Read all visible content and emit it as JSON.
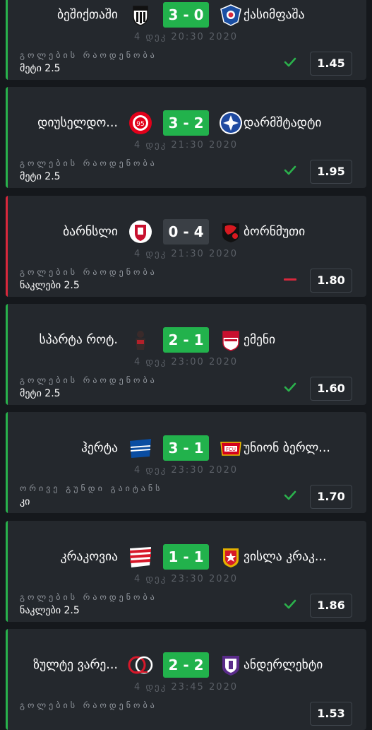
{
  "bets": [
    {
      "result": "win",
      "home": "ბეშიქთაში",
      "home_logo": "besiktas-logo",
      "score": "3 - 0",
      "score_style": "green",
      "away": "ქასიმფაშა",
      "away_logo": "kasimpasa-logo",
      "datetime": "4 დეკ 20:30 2020",
      "market": "გოლების რაოდენობა",
      "pick": "მეტი 2.5",
      "status_icon": "check-icon",
      "odds": "1.45"
    },
    {
      "result": "win",
      "home": "დიუსელდო...",
      "home_logo": "fortuna-dusseldorf-logo",
      "score": "3 - 2",
      "score_style": "green",
      "away": "დარმშტადტი",
      "away_logo": "darmstadt-logo",
      "datetime": "4 დეკ 21:30 2020",
      "market": "გოლების რაოდენობა",
      "pick": "მეტი 2.5",
      "status_icon": "check-icon",
      "odds": "1.95"
    },
    {
      "result": "loss",
      "home": "ბარნსლი",
      "home_logo": "barnsley-logo",
      "score": "0 - 4",
      "score_style": "dark",
      "away": "ბორნმუთი",
      "away_logo": "bournemouth-logo",
      "datetime": "4 დეკ 21:30 2020",
      "market": "გოლების რაოდენობა",
      "pick": "ნაკლები 2.5",
      "status_icon": "dash-icon",
      "odds": "1.80"
    },
    {
      "result": "win",
      "home": "სპარტა როტ.",
      "home_logo": "sparta-rotterdam-logo",
      "score": "2 - 1",
      "score_style": "green",
      "away": "ემენი",
      "away_logo": "emmen-logo",
      "datetime": "4 დეკ 23:00 2020",
      "market": "გოლების რაოდენობა",
      "pick": "მეტი 2.5",
      "status_icon": "check-icon",
      "odds": "1.60"
    },
    {
      "result": "win",
      "home": "ჰერტა",
      "home_logo": "hertha-logo",
      "score": "3 - 1",
      "score_style": "green",
      "away": "უნიონ ბერლ...",
      "away_logo": "union-berlin-logo",
      "datetime": "4 დეკ 23:30 2020",
      "market": "ორივე გუნდი გაიტანს",
      "pick": "კი",
      "status_icon": "check-icon",
      "odds": "1.70"
    },
    {
      "result": "win",
      "home": "კრაკოვია",
      "home_logo": "cracovia-logo",
      "score": "1 - 1",
      "score_style": "green",
      "away": "ვისლა კრაკ...",
      "away_logo": "wisla-krakow-logo",
      "datetime": "4 დეკ 23:30 2020",
      "market": "გოლების რაოდენობა",
      "pick": "ნაკლები 2.5",
      "status_icon": "check-icon",
      "odds": "1.86"
    },
    {
      "result": "win",
      "home": "ზულტე ვარე...",
      "home_logo": "zulte-waregem-logo",
      "score": "2 - 2",
      "score_style": "green",
      "away": "ანდერლეხტი",
      "away_logo": "anderlecht-logo",
      "datetime": "4 დეკ 23:45 2020",
      "market": "გოლების რაოდენობა",
      "pick": "",
      "status_icon": "check-icon",
      "odds": "1.53"
    }
  ],
  "colors": {
    "win": "#28b14c",
    "loss": "#d8283c",
    "check": "#2bb24c",
    "dash": "#d8283c"
  }
}
